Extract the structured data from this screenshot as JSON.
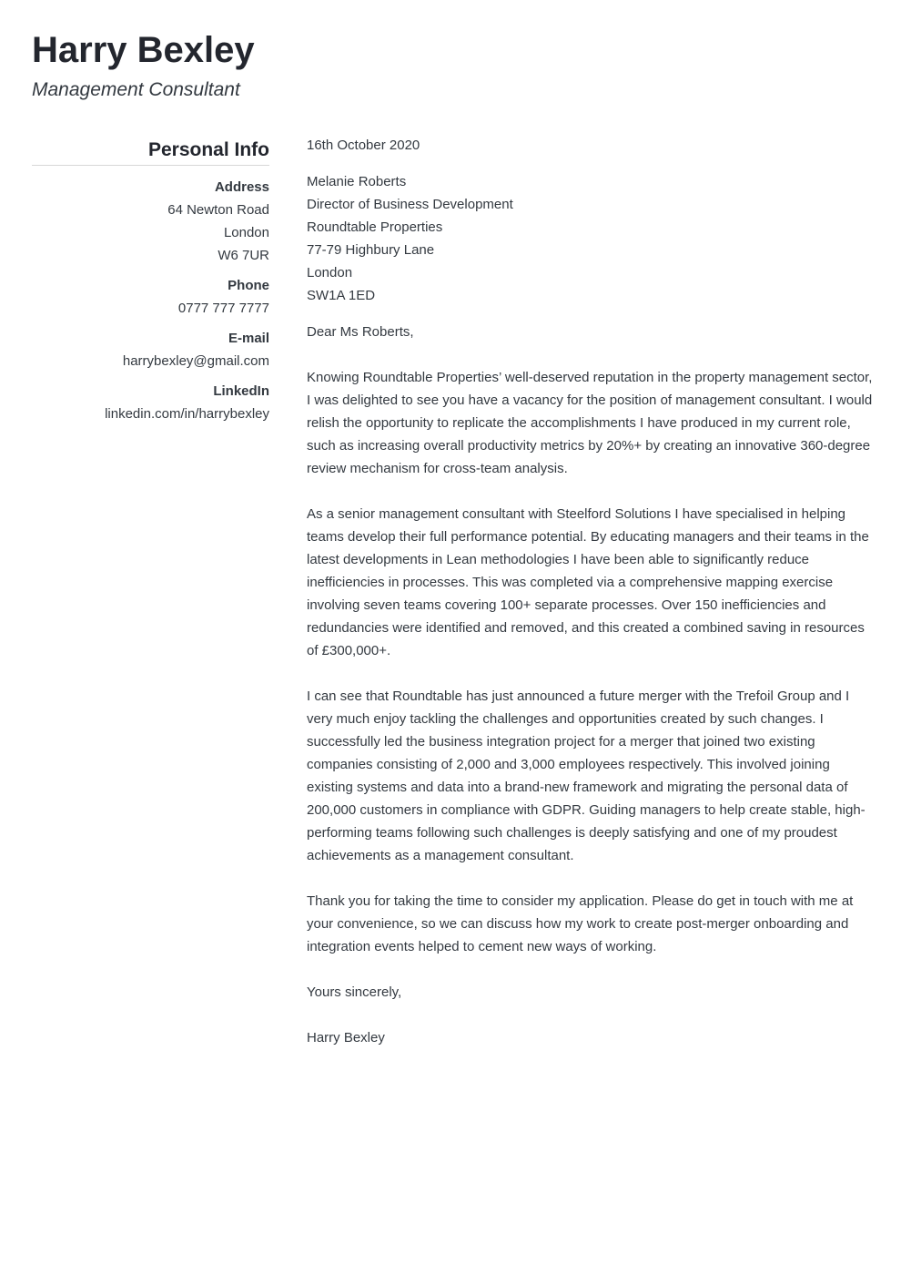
{
  "header": {
    "name": "Harry Bexley",
    "job_title": "Management Consultant"
  },
  "sidebar": {
    "heading": "Personal Info",
    "address": {
      "label": "Address",
      "lines": [
        "64 Newton Road",
        "London",
        "W6 7UR"
      ]
    },
    "phone": {
      "label": "Phone",
      "value": "0777 777 7777"
    },
    "email": {
      "label": "E-mail",
      "value": "harrybexley@gmail.com"
    },
    "linkedin": {
      "label": "LinkedIn",
      "value": "linkedin.com/in/harrybexley"
    }
  },
  "letter": {
    "date": "16th October 2020",
    "recipient": [
      "Melanie Roberts",
      "Director of Business Development",
      "Roundtable Properties",
      "77-79 Highbury Lane",
      "London",
      "SW1A 1ED"
    ],
    "greeting": "Dear Ms Roberts,",
    "paragraphs": [
      "Knowing Roundtable Properties’ well-deserved reputation in the property management sector, I was delighted to see you have a vacancy for the position of management consultant. I would relish the opportunity to replicate the accomplishments I have produced in my current role, such as increasing overall productivity metrics by 20%+ by creating an innovative 360-degree review mechanism for cross-team analysis.",
      "As a senior management consultant with Steelford Solutions I have specialised in helping teams develop their full performance potential. By educating managers and their teams in the latest developments in Lean methodologies I have been able to significantly reduce inefficiencies in processes. This was completed via a comprehensive mapping exercise involving seven teams covering 100+ separate processes. Over 150 inefficiencies and redundancies were identified and removed, and this created a combined saving in resources of £300,000+.",
      "I can see that Roundtable has just announced a future merger with the Trefoil Group and I very much enjoy tackling the challenges and opportunities created by such changes. I successfully led the business integration project for a merger that joined two existing companies consisting of 2,000 and 3,000 employees respectively. This involved joining existing systems and data into a brand-new framework and migrating the personal data of 200,000 customers in compliance with GDPR. Guiding managers to help create stable, high-performing teams following such challenges is deeply satisfying and one of my proudest achievements as a management consultant.",
      "Thank you for taking the time to consider my application. Please do get in touch with me at your convenience, so we can discuss how my work to create post-merger onboarding and integration events helped to cement new ways of working."
    ],
    "closing": "Yours sincerely,",
    "signature": "Harry Bexley"
  }
}
